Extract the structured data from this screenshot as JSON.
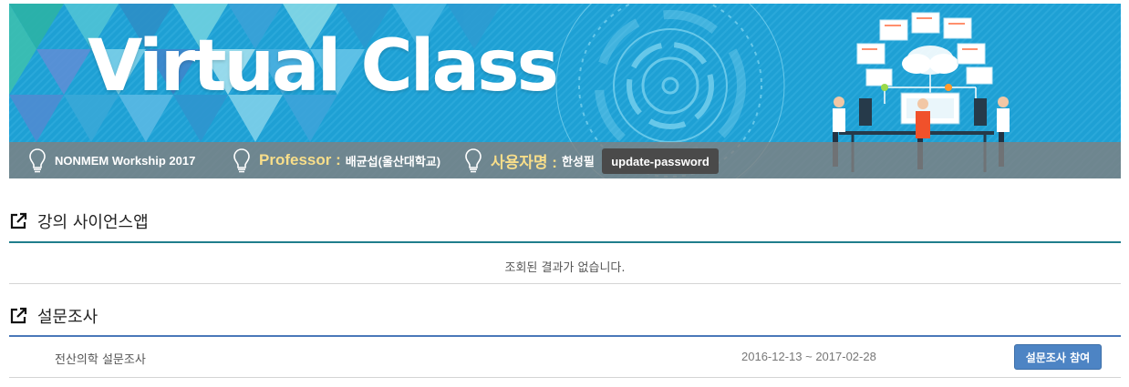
{
  "banner": {
    "title": "Virtual Class",
    "course": "NONMEM Workship 2017",
    "professor_label": "Professor :",
    "professor_name": "배균섭(울산대학교)",
    "user_label": "사용자명 :",
    "user_name": "한성필",
    "password_button": "update-password"
  },
  "sections": {
    "science_app": {
      "title": "강의 사이언스앱",
      "empty_message": "조회된 결과가 없습니다."
    },
    "survey": {
      "title": "설문조사",
      "items": [
        {
          "name": "전산의학 설문조사",
          "period": "2016-12-13 ~ 2017-02-28",
          "action": "설문조사 참여"
        }
      ]
    }
  },
  "colors": {
    "banner_blue": "#1ea0d4",
    "info_bar_grey": "#808080",
    "label_gold": "#f8de8a",
    "teal_rule": "#1f7e8c",
    "blue_rule": "#4a78b9",
    "action_button": "#4d84c4"
  },
  "icons": {
    "bulb": "lightbulb-icon",
    "section": "external-link-icon"
  }
}
